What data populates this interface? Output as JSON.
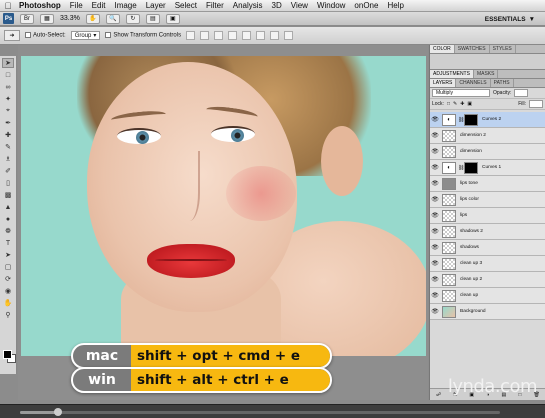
{
  "menubar": {
    "app": "Photoshop",
    "items": [
      "File",
      "Edit",
      "Image",
      "Layer",
      "Select",
      "Filter",
      "Analysis",
      "3D",
      "View",
      "Window",
      "onOne",
      "Help"
    ]
  },
  "appbar": {
    "logo": "Ps",
    "zoom": "33.3%",
    "workspace": "ESSENTIALS"
  },
  "optionsbar": {
    "auto_select_label": "Auto-Select:",
    "auto_select_value": "Group",
    "transform_label": "Show Transform Controls"
  },
  "shortcuts": {
    "mac_label": "mac",
    "mac_keys": "shift + opt + cmd + e",
    "win_label": "win",
    "win_keys": "shift + alt + ctrl + e"
  },
  "panels": {
    "top_tabs": [
      "COLOR",
      "SWATCHES",
      "STYLES"
    ],
    "mid_tabs": [
      "ADJUSTMENTS",
      "MASKS"
    ],
    "layer_tabs": [
      "LAYERS",
      "CHANNELS",
      "PATHS"
    ],
    "blend_mode": "Multiply",
    "opacity_label": "Opacity:",
    "lock_label": "Lock:",
    "fill_label": "Fill:",
    "layers": [
      {
        "name": "Curves 2",
        "thumb": "adj",
        "mask": true,
        "selected": true
      },
      {
        "name": "dimension 2",
        "thumb": "checker",
        "mask": false,
        "selected": false
      },
      {
        "name": "dimension",
        "thumb": "checker",
        "mask": false,
        "selected": false
      },
      {
        "name": "Curves 1",
        "thumb": "adj",
        "mask": true,
        "selected": false
      },
      {
        "name": "lips tone",
        "thumb": "gray",
        "mask": false,
        "selected": false
      },
      {
        "name": "lips color",
        "thumb": "checker",
        "mask": false,
        "selected": false
      },
      {
        "name": "lips",
        "thumb": "checker",
        "mask": false,
        "selected": false
      },
      {
        "name": "shadows 2",
        "thumb": "checker",
        "mask": false,
        "selected": false
      },
      {
        "name": "shadows",
        "thumb": "checker",
        "mask": false,
        "selected": false
      },
      {
        "name": "clean up 3",
        "thumb": "checker",
        "mask": false,
        "selected": false
      },
      {
        "name": "clean up 2",
        "thumb": "checker",
        "mask": false,
        "selected": false
      },
      {
        "name": "clean up",
        "thumb": "checker",
        "mask": false,
        "selected": false
      },
      {
        "name": "Background",
        "thumb": "photo",
        "mask": false,
        "selected": false
      }
    ]
  },
  "watermark": "lynda.com",
  "playback": {
    "progress": 0.08
  }
}
